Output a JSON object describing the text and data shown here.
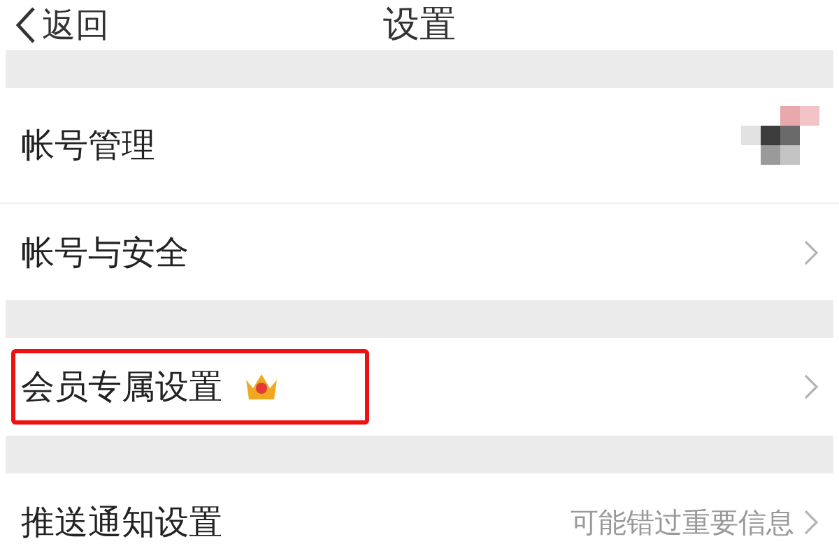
{
  "nav": {
    "back": "返回",
    "title": "设置"
  },
  "groups": [
    {
      "items": [
        {
          "kind": "avatar",
          "label": "帐号管理",
          "highlighted": false
        },
        {
          "kind": "link",
          "label": "帐号与安全",
          "highlighted": false
        }
      ]
    },
    {
      "items": [
        {
          "kind": "crown",
          "label": "会员专属设置",
          "highlighted": true
        }
      ]
    },
    {
      "items": [
        {
          "kind": "link",
          "label": "推送通知设置",
          "value": "可能错过重要信息",
          "highlighted": false
        }
      ]
    }
  ]
}
